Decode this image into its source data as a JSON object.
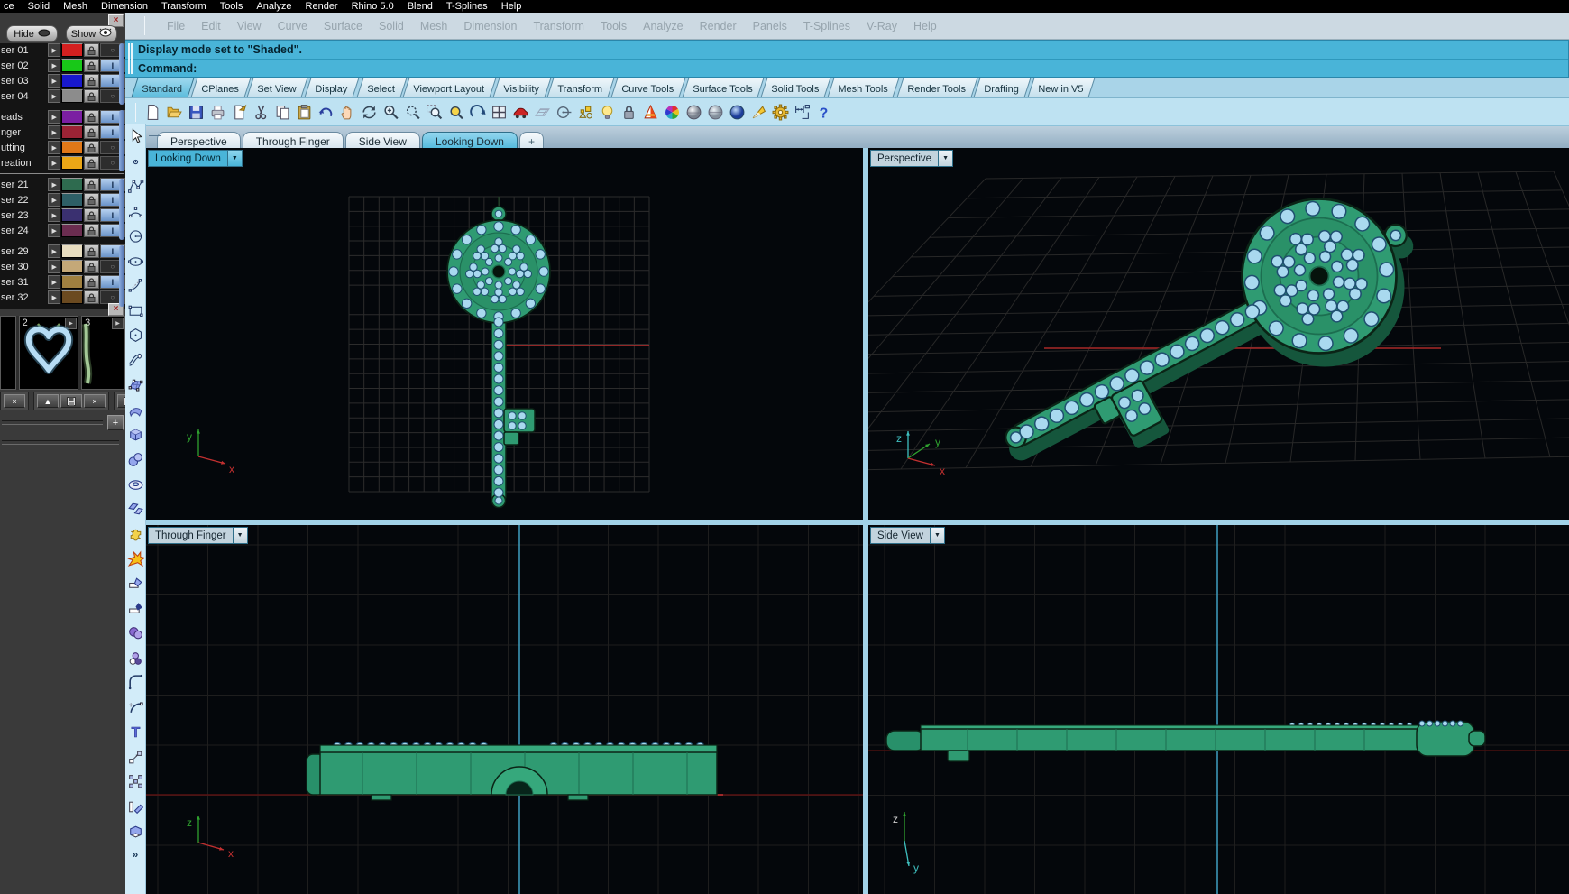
{
  "system_menubar": {
    "items": [
      "ce",
      "Solid",
      "Mesh",
      "Dimension",
      "Transform",
      "Tools",
      "Analyze",
      "Render",
      "Rhino 5.0",
      "Blend",
      "T-Splines",
      "Help"
    ]
  },
  "rhino_menubar": {
    "items": [
      "File",
      "Edit",
      "View",
      "Curve",
      "Surface",
      "Solid",
      "Mesh",
      "Dimension",
      "Transform",
      "Tools",
      "Analyze",
      "Render",
      "Panels",
      "T-Splines",
      "V-Ray",
      "Help"
    ]
  },
  "command_area": {
    "history_line": "Display mode set to \"Shaded\".",
    "prompt_label": "Command:"
  },
  "toolbar_tabs": {
    "active": "Standard",
    "tabs": [
      "Standard",
      "CPlanes",
      "Set View",
      "Display",
      "Select",
      "Viewport Layout",
      "Visibility",
      "Transform",
      "Curve Tools",
      "Surface Tools",
      "Solid Tools",
      "Mesh Tools",
      "Render Tools",
      "Drafting",
      "New in V5"
    ]
  },
  "standard_toolbar": {
    "icons": [
      "new-file",
      "open-file",
      "save",
      "print",
      "copy-page",
      "cut",
      "copy",
      "paste",
      "undo",
      "pan",
      "rotate-view",
      "zoom-in",
      "zoom-dynamic",
      "zoom-window",
      "zoom-selected",
      "undo-view",
      "viewport-layout",
      "car",
      "cplane",
      "circle-line",
      "osnap",
      "light-bulb",
      "lock",
      "flamingo",
      "color-wheel",
      "sphere-shaded",
      "sphere-ghosted",
      "sphere-render",
      "paint",
      "gear",
      "dimension",
      "help"
    ]
  },
  "viewport_tab_bar": {
    "tabs": [
      "Perspective",
      "Through Finger",
      "Side View",
      "Looking Down"
    ],
    "active": "Looking Down",
    "add_tab_label": "+"
  },
  "side_toolbar": {
    "more_label": "»",
    "icons": [
      "pointer",
      "point",
      "polyline",
      "arc",
      "circle",
      "ellipse",
      "corner-curve",
      "rectangle",
      "polygon",
      "pipe",
      "control-surface",
      "curved-surface",
      "box",
      "spheres",
      "torus",
      "patches",
      "puzzle",
      "explode",
      "trim",
      "split",
      "boolean-union",
      "boolean-diff",
      "fillet",
      "extend",
      "text",
      "move",
      "array",
      "knife",
      "cage"
    ]
  },
  "layers_panel": {
    "hide_button": "Hide",
    "show_button": "Show",
    "rows": [
      {
        "label": "ser 01",
        "color": "#d42020",
        "state": "off",
        "section": 1
      },
      {
        "label": "ser 02",
        "color": "#18c818",
        "state": "on",
        "section": 1
      },
      {
        "label": "ser 03",
        "color": "#1818cc",
        "state": "on",
        "section": 1
      },
      {
        "label": "ser 04",
        "color": "#8c8c8c",
        "state": "off",
        "section": 1
      },
      {
        "label": "eads",
        "color": "#7b1fa2",
        "state": "on",
        "section": 2
      },
      {
        "label": "nger",
        "color": "#9b2335",
        "state": "on",
        "section": 2
      },
      {
        "label": "utting",
        "color": "#e07818",
        "state": "off",
        "section": 2
      },
      {
        "label": "reation",
        "color": "#eaa616",
        "state": "off",
        "section": 2
      },
      {
        "label": "ser 21",
        "color": "#2e6b4f",
        "state": "on",
        "section": 3
      },
      {
        "label": "ser 22",
        "color": "#2e5f66",
        "state": "on",
        "section": 3
      },
      {
        "label": "ser 23",
        "color": "#3a3070",
        "state": "on",
        "section": 3
      },
      {
        "label": "ser 24",
        "color": "#6b2d50",
        "state": "on",
        "section": 3
      },
      {
        "label": "ser 29",
        "color": "#e8ddc0",
        "state": "on",
        "section": 4
      },
      {
        "label": "ser 30",
        "color": "#c4a878",
        "state": "off",
        "section": 4
      },
      {
        "label": "ser 31",
        "color": "#a08040",
        "state": "on",
        "section": 4
      },
      {
        "label": "ser 32",
        "color": "#6b4a20",
        "state": "off",
        "section": 4
      }
    ]
  },
  "thumbnails_panel": {
    "add_button_label": "+",
    "slots": [
      {
        "label": "2",
        "content": "heart"
      },
      {
        "label": "3",
        "content": "sliver"
      }
    ]
  },
  "viewports": {
    "looking_down": {
      "name": "Looking Down",
      "menu_arrow": "▼",
      "active": true,
      "axis": [
        {
          "label": "y",
          "color": "#2fa12f"
        },
        {
          "label": "x",
          "color": "#c23030"
        }
      ]
    },
    "perspective": {
      "name": "Perspective",
      "menu_arrow": "▼",
      "active": false,
      "axis": [
        {
          "label": "z",
          "color": "#3fc0c0"
        },
        {
          "label": "y",
          "color": "#2fa12f"
        },
        {
          "label": "x",
          "color": "#c23030"
        }
      ]
    },
    "through_finger": {
      "name": "Through Finger",
      "menu_arrow": "▼",
      "active": false,
      "axis": [
        {
          "label": "z",
          "color": "#2fa12f"
        },
        {
          "label": "x",
          "color": "#c23030"
        }
      ]
    },
    "side_view": {
      "name": "Side View",
      "menu_arrow": "▼",
      "active": false,
      "axis": [
        {
          "label": "z",
          "color": "#2fa12f"
        },
        {
          "label": "y",
          "color": "#3fc0c0"
        }
      ]
    }
  },
  "palette": {
    "accent_cyan": "#49b4d8",
    "key_green": "#2f9b72",
    "key_green_dark": "#1d6b4c",
    "bead_blue": "#a9d9ef",
    "axis_red": "#c23030",
    "cplane_cyan": "#3f9fc2",
    "grid_gray": "#2c2c2c"
  }
}
